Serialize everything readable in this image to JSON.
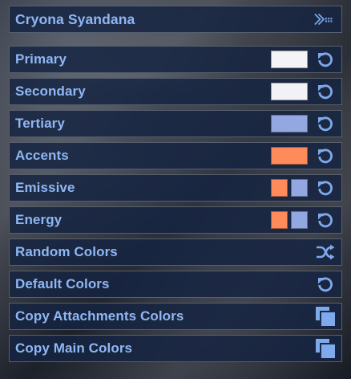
{
  "panel": {
    "title": "Cryona Syandana",
    "title_icon": "chevrons-menu-icon"
  },
  "colors": {
    "accent_text": "#8fb7f3",
    "icon": "#7ea9ea",
    "row_background": "#162442",
    "row_border": "#54606f"
  },
  "channels": [
    {
      "label": "Primary",
      "swatches": [
        "#f4f4f6"
      ],
      "reset_icon": "reset-icon"
    },
    {
      "label": "Secondary",
      "swatches": [
        "#f2f2f6"
      ],
      "reset_icon": "reset-icon"
    },
    {
      "label": "Tertiary",
      "swatches": [
        "#93a8e0"
      ],
      "reset_icon": "reset-icon"
    },
    {
      "label": "Accents",
      "swatches": [
        "#ff8a5a"
      ],
      "reset_icon": "reset-icon"
    },
    {
      "label": "Emissive",
      "swatches": [
        "#ff8a5a",
        "#93a8e0"
      ],
      "reset_icon": "reset-icon"
    },
    {
      "label": "Energy",
      "swatches": [
        "#ff8a5a",
        "#93a8e0"
      ],
      "reset_icon": "reset-icon"
    }
  ],
  "actions": [
    {
      "label": "Random Colors",
      "icon": "shuffle-icon"
    },
    {
      "label": "Default Colors",
      "icon": "reset-icon"
    },
    {
      "label": "Copy Attachments Colors",
      "icon": "copy-icon"
    },
    {
      "label": "Copy Main Colors",
      "icon": "copy-icon"
    }
  ]
}
